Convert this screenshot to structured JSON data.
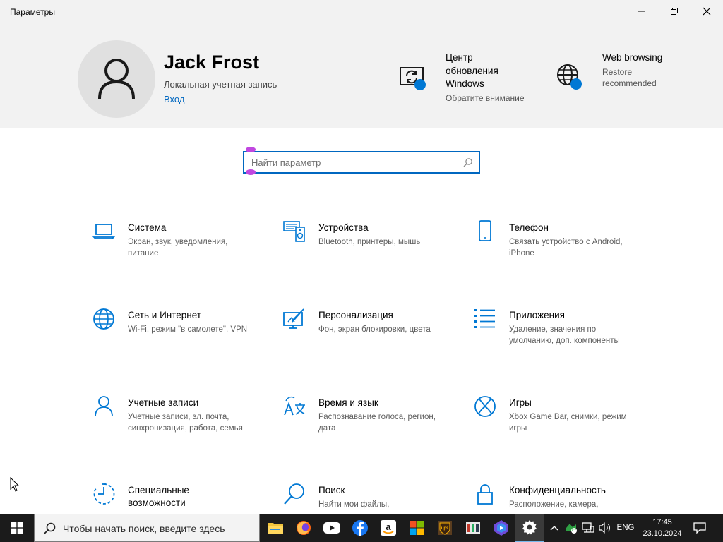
{
  "window": {
    "title": "Параметры"
  },
  "account": {
    "name": "Jack Frost",
    "type": "Локальная учетная запись",
    "link": "Вход"
  },
  "header_items": [
    {
      "title": "Центр обновления Windows",
      "title_lines": [
        "Центр",
        "обновления",
        "Windows"
      ],
      "subtitle": "Обратите внимание",
      "icon": "windows-update-icon"
    },
    {
      "title": "Web browsing",
      "subtitle_lines": [
        "Restore",
        "recommended"
      ],
      "icon": "globe-icon"
    }
  ],
  "search": {
    "placeholder": "Найти параметр"
  },
  "tiles": [
    {
      "title": "Система",
      "desc": "Экран, звук, уведомления, питание",
      "icon": "laptop-icon"
    },
    {
      "title": "Устройства",
      "desc": "Bluetooth, принтеры, мышь",
      "icon": "devices-icon"
    },
    {
      "title": "Телефон",
      "desc": "Связать устройство с Android, iPhone",
      "icon": "phone-icon"
    },
    {
      "title": "Сеть и Интернет",
      "desc": "Wi-Fi, режим \"в самолете\", VPN",
      "icon": "globe-icon"
    },
    {
      "title": "Персонализация",
      "desc": "Фон, экран блокировки, цвета",
      "icon": "personalization-icon"
    },
    {
      "title": "Приложения",
      "desc": "Удаление, значения по умолчанию, доп. компоненты",
      "icon": "apps-list-icon"
    },
    {
      "title": "Учетные записи",
      "desc": "Учетные записи, эл. почта, синхронизация, работа, семья",
      "icon": "person-icon"
    },
    {
      "title": "Время и язык",
      "desc": "Распознавание голоса, регион, дата",
      "icon": "time-language-icon"
    },
    {
      "title": "Игры",
      "desc": "Xbox Game Bar, снимки, режим игры",
      "icon": "xbox-icon"
    },
    {
      "title": "Специальные возможности",
      "desc": "",
      "icon": "accessibility-icon"
    },
    {
      "title": "Поиск",
      "desc": "Найти мои файлы,",
      "icon": "search-icon"
    },
    {
      "title": "Конфиденциальность",
      "desc": "Расположение, камера,",
      "icon": "lock-icon"
    }
  ],
  "taskbar": {
    "search_text": "Чтобы начать поиск, введите здесь",
    "apps": [
      "file-explorer-icon",
      "firefox-icon",
      "youtube-icon",
      "facebook-icon",
      "amazon-icon",
      "microsoft-store-icon",
      "ups-icon",
      "app-icon",
      "media-player-icon",
      "settings-icon"
    ],
    "language": "ENG",
    "time": "17:45",
    "date": "23.10.2024"
  },
  "colors": {
    "accent": "#0067c0",
    "icon_blue": "#0078d4",
    "header_bg": "#f2f2f2",
    "taskbar_bg": "#1b1b1b"
  }
}
